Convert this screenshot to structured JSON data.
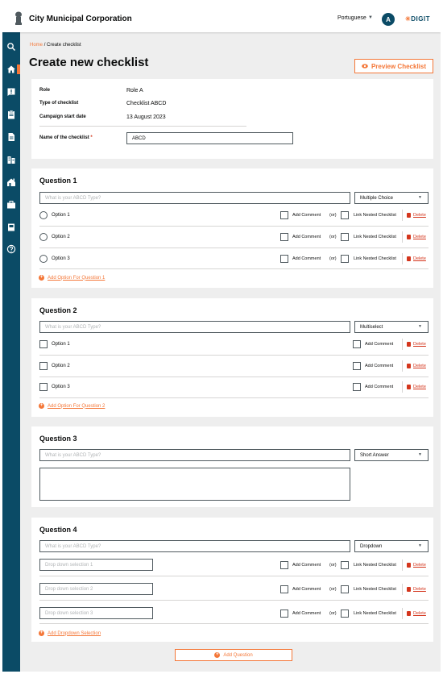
{
  "header": {
    "city": "City Municipal Corporation",
    "language": "Portuguese",
    "avatar_letter": "A",
    "brand": "DIGIT"
  },
  "sidebar": {
    "icons": [
      "search-icon",
      "home-icon",
      "inbox-icon",
      "clipboard-icon",
      "document-icon",
      "building-icon",
      "house-icon",
      "briefcase-icon",
      "book-icon",
      "help-icon"
    ]
  },
  "breadcrumb": {
    "home": "Home",
    "sep": "/",
    "current": "Create checklist"
  },
  "page_title": "Create new checklist",
  "preview_button": "Preview Checklist",
  "details": {
    "role_label": "Role",
    "role_value": "Role A",
    "type_label": "Type of checklist",
    "type_value": "Checklist ABCD",
    "date_label": "Campaign start date",
    "date_value": "13 August 2023",
    "name_label": "Name of the checklist",
    "name_required": "*",
    "name_value": "ABCD"
  },
  "common": {
    "question_placeholder": "What is your ABCD Type?",
    "add_comment": "Add Comment",
    "or": "(or)",
    "link_nested": "Link Nested Checklist",
    "delete": "Delete"
  },
  "q1": {
    "title": "Question 1",
    "type": "Multiple Choice",
    "options": [
      "Option 1",
      "Option 2",
      "Option 3"
    ],
    "add_option": "Add Option For  Question 1"
  },
  "q2": {
    "title": "Question 2",
    "type": "Multiselect",
    "options": [
      "Option 1",
      "Option 2",
      "Option 3"
    ],
    "add_option": "Add Option For Question 2"
  },
  "q3": {
    "title": "Question 3",
    "type": "Short Answer"
  },
  "q4": {
    "title": "Question 4",
    "type": "Dropdown",
    "options": [
      "Drop down selection 1",
      "Drop down selection 2",
      "Drop down selection 3"
    ],
    "add_option": "Add Dropdown Selection"
  },
  "add_question": "Add Question"
}
